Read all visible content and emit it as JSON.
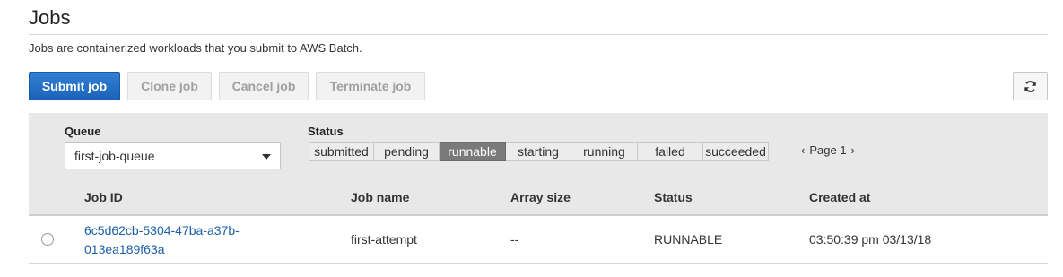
{
  "header": {
    "title": "Jobs",
    "description": "Jobs are containerized workloads that you submit to AWS Batch."
  },
  "toolbar": {
    "submit_label": "Submit job",
    "clone_label": "Clone job",
    "cancel_label": "Cancel job",
    "terminate_label": "Terminate job",
    "refresh_icon": "refresh-icon"
  },
  "filters": {
    "queue_label": "Queue",
    "queue_value": "first-job-queue",
    "status_label": "Status",
    "statuses": [
      "submitted",
      "pending",
      "runnable",
      "starting",
      "running",
      "failed",
      "succeeded"
    ],
    "active_status": "runnable",
    "page_label": "Page 1"
  },
  "table": {
    "columns": [
      "Job ID",
      "Job name",
      "Array size",
      "Status",
      "Created at"
    ],
    "rows": [
      {
        "job_id_line1": "6c5d62cb-5304-47ba-a37b-",
        "job_id_line2": "013ea189f63a",
        "job_name": "first-attempt",
        "array_size": "--",
        "status": "RUNNABLE",
        "created_at": "03:50:39 pm 03/13/18"
      }
    ]
  },
  "colors": {
    "primary": "#1c63b8",
    "link": "#1a5fa8",
    "panel": "#e8e8e8",
    "active_segment": "#7a7a7a"
  }
}
